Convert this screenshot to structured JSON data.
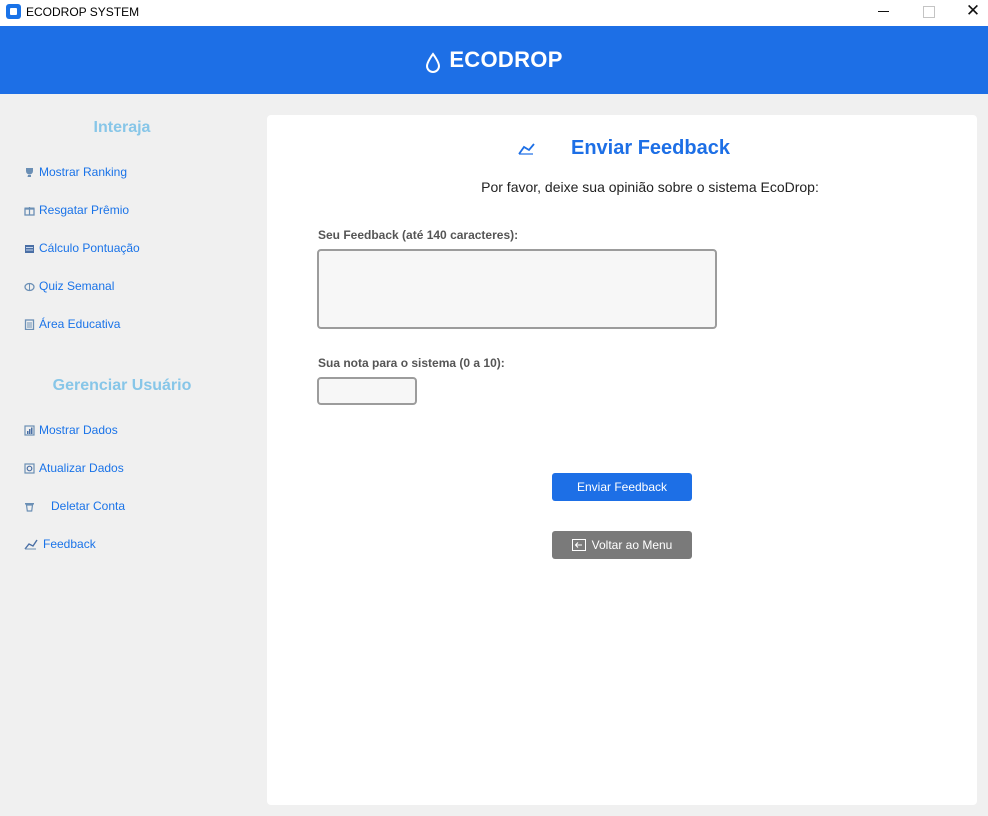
{
  "window": {
    "title": "ECODROP SYSTEM"
  },
  "header": {
    "title": "ECODROP",
    "icon": "water-drop-icon"
  },
  "sidebar": {
    "sections": [
      {
        "title": "Interaja",
        "items": [
          {
            "label": "Mostrar Ranking",
            "icon": "trophy-icon"
          },
          {
            "label": "Resgatar Prêmio",
            "icon": "gift-icon"
          },
          {
            "label": "Cálculo Pontuação",
            "icon": "calculator-icon"
          },
          {
            "label": "Quiz Semanal",
            "icon": "brain-icon"
          },
          {
            "label": "Área Educativa",
            "icon": "book-icon"
          }
        ]
      },
      {
        "title": "Gerenciar Usuário",
        "items": [
          {
            "label": "Mostrar Dados",
            "icon": "chart-icon"
          },
          {
            "label": "Atualizar Dados",
            "icon": "refresh-icon"
          },
          {
            "label": "Deletar Conta",
            "icon": "trash-icon"
          },
          {
            "label": "Feedback",
            "icon": "writing-hand-icon"
          }
        ]
      }
    ]
  },
  "main": {
    "title": "Enviar Feedback",
    "subtitle": "Por favor, deixe sua opinião sobre o sistema EcoDrop:",
    "feedback_label": "Seu Feedback (até 140 caracteres):",
    "feedback_value": "",
    "rating_label": "Sua nota para o sistema (0 a 10):",
    "rating_value": "",
    "send_button": "Enviar Feedback",
    "back_button": "Voltar ao Menu"
  },
  "colors": {
    "primary": "#1d6fe6",
    "section_title": "#87c6e8",
    "back_button": "#7a7a7a"
  }
}
